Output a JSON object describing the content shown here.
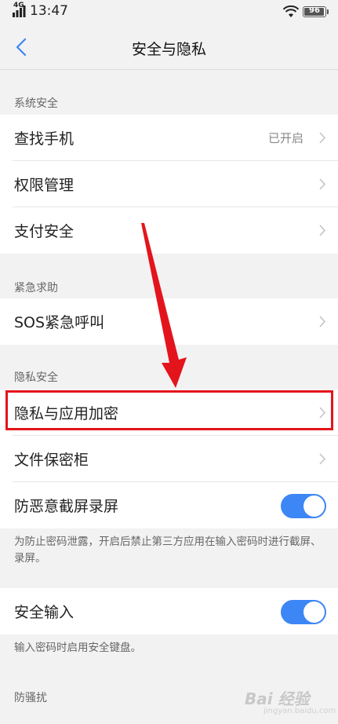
{
  "status_bar": {
    "network": "4G",
    "time": "13:47",
    "battery": "96",
    "battery_level": 0.96,
    "icons": [
      "signal-icon",
      "wifi-icon",
      "battery-icon"
    ]
  },
  "header": {
    "title": "安全与隐私",
    "back_icon": "chevron-left-icon"
  },
  "sections": {
    "system": {
      "label": "系统安全",
      "items": [
        {
          "label": "查找手机",
          "value": "已开启"
        },
        {
          "label": "权限管理"
        },
        {
          "label": "支付安全"
        }
      ]
    },
    "emergency": {
      "label": "紧急求助",
      "items": [
        {
          "label": "SOS紧急呼叫"
        }
      ]
    },
    "privacy": {
      "label": "隐私安全",
      "items": [
        {
          "label": "隐私与应用加密"
        },
        {
          "label": "文件保密柜"
        },
        {
          "label": "防恶意截屏录屏",
          "toggle": true
        }
      ],
      "description": "为防止密码泄露，开启后禁止第三方应用在输入密码时进行截屏、录屏。"
    },
    "input": {
      "items": [
        {
          "label": "安全输入",
          "toggle": true
        }
      ],
      "description": "输入密码时启用安全键盘。"
    },
    "harassment": {
      "label": "防骚扰"
    }
  },
  "annotation": {
    "arrow_color": "#e3141c",
    "highlight_color": "#e3141c"
  },
  "watermark": {
    "text": "Bai 经验",
    "sub": "jingyan.baidu.com"
  },
  "colors": {
    "toggle_on": "#3d86f5",
    "background": "#f2f2f2"
  }
}
